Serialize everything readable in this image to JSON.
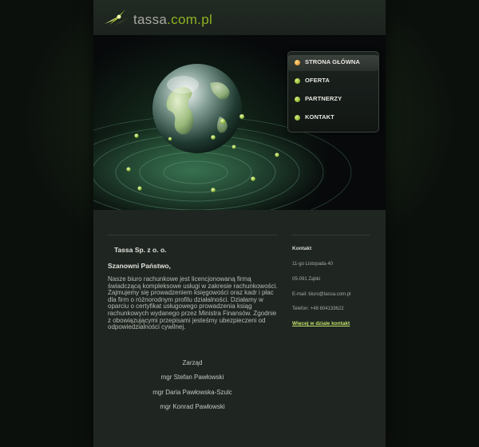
{
  "header": {
    "logo_prefix": "tassa",
    "logo_suffix": ".com.pl"
  },
  "nav": {
    "items": [
      {
        "label": "STRONA GŁÓWNA",
        "active": true
      },
      {
        "label": "OFERTA",
        "active": false
      },
      {
        "label": "PARTNERZY",
        "active": false
      },
      {
        "label": "KONTAKT",
        "active": false
      }
    ]
  },
  "main": {
    "company": "Tassa Sp. z o. o.",
    "greeting": "Szanowni Państwo,",
    "intro": "Nasze biuro rachunkowe jest licencjonowaną firmą świadczącą kompleksowe usługi w zakresie rachunkowości. Zajmujemy się prowadzeniem księgowości oraz kadr i płac dla firm o różnorodnym profilu działalności. Działamy w oparciu o certyfikat usługowego prowadzenia ksiąg rachunkowych wydanego przez Ministra Finansów. Zgodnie z obowiązującymi przepisami jesteśmy ubezpieczeni od odpowiedzialności cywilnej.",
    "signature": {
      "title": "Zarząd",
      "names": [
        "mgr Stefan Pawłowski",
        "mgr Daria Pawłowska-Szulc",
        "mgr Konrad Pawłowski"
      ]
    }
  },
  "contact": {
    "heading": "Kontakt",
    "address": "11-go Listopada 40",
    "city": "05-091 Ząbki",
    "email": "E-mail: biuro@tassa.com.pl",
    "phone": "Telefon: +48 604133622",
    "more_link": "Więcej w dziale kontakt"
  },
  "colors": {
    "accent": "#8fb321",
    "link": "#c3e06a",
    "active_bullet": "#d97a12",
    "background": "#0c0f0d",
    "column": "#1f2621"
  }
}
